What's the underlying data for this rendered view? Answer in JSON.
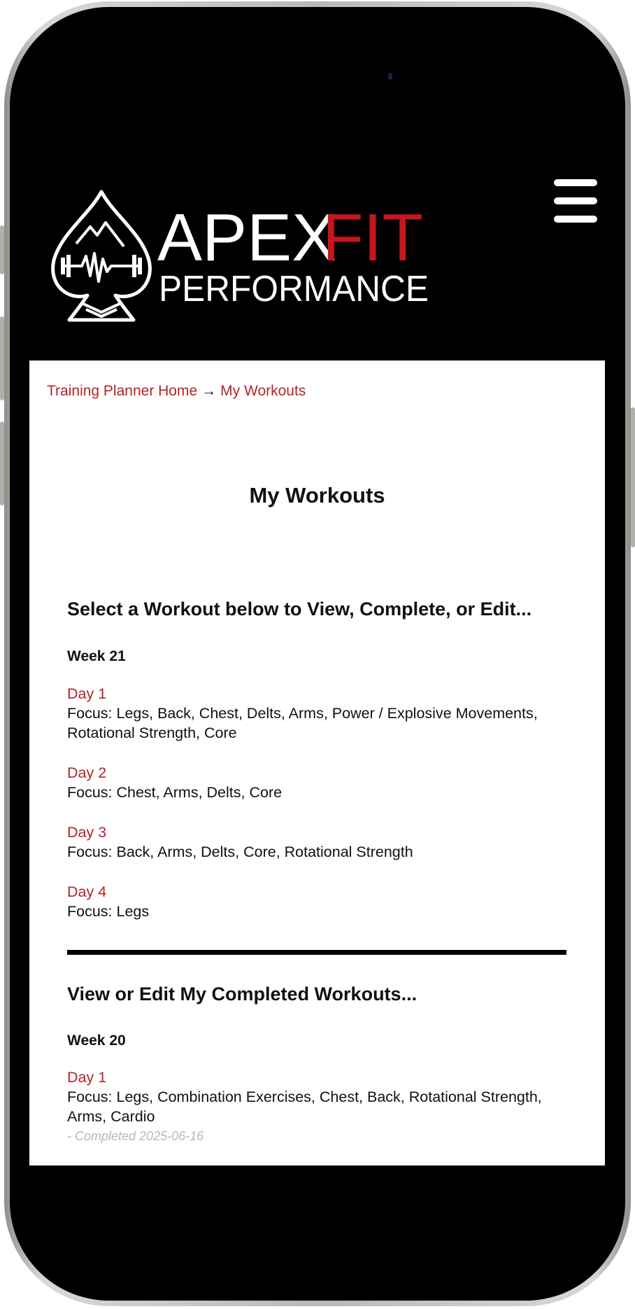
{
  "header": {
    "brand_top_left": "APEX",
    "brand_top_right": "FIT",
    "brand_bottom": "PERFORMANCE",
    "brand_accent_color": "#c8161d",
    "menu_icon": "hamburger-menu-icon"
  },
  "breadcrumb": {
    "home_label": "Training Planner Home",
    "separator": "→",
    "current_label": "My Workouts"
  },
  "page_title": "My Workouts",
  "upcoming": {
    "heading": "Select a Workout below to View, Complete, or Edit...",
    "week_label": "Week 21",
    "workouts": [
      {
        "day": "Day 1",
        "focus": "Focus: Legs, Back, Chest, Delts, Arms, Power / Explosive Movements, Rotational Strength, Core"
      },
      {
        "day": "Day 2",
        "focus": "Focus: Chest, Arms, Delts, Core"
      },
      {
        "day": "Day 3",
        "focus": "Focus: Back, Arms, Delts, Core, Rotational Strength"
      },
      {
        "day": "Day 4",
        "focus": "Focus: Legs"
      }
    ]
  },
  "completed": {
    "heading": "View or Edit My Completed Workouts...",
    "week_label": "Week 20",
    "workouts": [
      {
        "day": "Day 1",
        "focus": "Focus: Legs, Combination Exercises, Chest, Back, Rotational Strength, Arms, Cardio",
        "status": "- Completed 2025-06-16"
      }
    ]
  },
  "colors": {
    "link": "#b3232a",
    "text": "#111111",
    "muted": "#b8b8b8",
    "background": "#000000",
    "panel": "#ffffff"
  }
}
